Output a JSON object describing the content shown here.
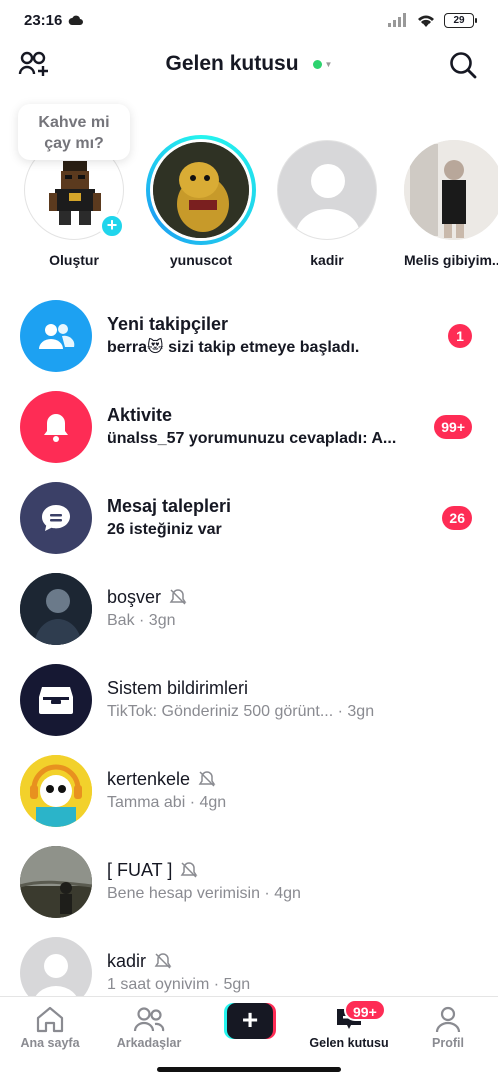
{
  "status": {
    "time": "23:16",
    "battery": "29"
  },
  "header": {
    "title": "Gelen kutusu"
  },
  "stories": {
    "bubble_line1": "Kahve mi",
    "bubble_line2": "çay mı?",
    "items": [
      {
        "name": "Oluştur"
      },
      {
        "name": "yunuscot"
      },
      {
        "name": "kadir"
      },
      {
        "name": "Melis gibiyim.."
      }
    ]
  },
  "rows": [
    {
      "title": "Yeni takipçiler",
      "subtitle": "berra😻 sizi takip etmeye başladı.",
      "badge": "1",
      "icon": "followers-icon",
      "color": "#1da1f2"
    },
    {
      "title": "Aktivite",
      "subtitle": "ünalss_57 yorumunuzu cevapladı: A...",
      "badge": "99+",
      "icon": "bell-icon",
      "color": "#fe2c55"
    },
    {
      "title": "Mesaj talepleri",
      "subtitle": "26 isteğiniz var",
      "badge": "26",
      "icon": "message-icon",
      "color": "#3b4067"
    },
    {
      "title": "boşver",
      "subtitle": "Bak · 3gn",
      "muted": true
    },
    {
      "title": "Sistem bildirimleri",
      "subtitle": "TikTok: Gönderiniz 500 görünt... · 3gn",
      "icon": "inbox-tray-icon",
      "color": "#161833"
    },
    {
      "title": "kertenkele",
      "subtitle": "Tamma abi · 4gn",
      "muted": true
    },
    {
      "title": "[ FUAT ]",
      "subtitle": "Bene hesap verimisin · 4gn",
      "muted": true
    },
    {
      "title": "kadir",
      "subtitle": "1 saat oynivim · 5gn",
      "muted": true
    }
  ],
  "tabs": [
    {
      "label": "Ana sayfa"
    },
    {
      "label": "Arkadaşlar"
    },
    {
      "label": "Gelen kutusu",
      "badge": "99+"
    },
    {
      "label": "Profil"
    }
  ]
}
